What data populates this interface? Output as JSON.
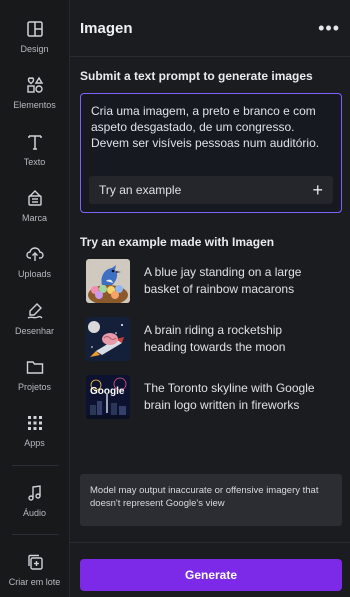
{
  "sidebar": {
    "items": [
      {
        "label": "Design",
        "icon": "layout-icon"
      },
      {
        "label": "Elementos",
        "icon": "shapes-icon"
      },
      {
        "label": "Texto",
        "icon": "text-icon"
      },
      {
        "label": "Marca",
        "icon": "brand-icon"
      },
      {
        "label": "Uploads",
        "icon": "upload-icon"
      },
      {
        "label": "Desenhar",
        "icon": "draw-icon"
      },
      {
        "label": "Projetos",
        "icon": "folder-icon"
      },
      {
        "label": "Apps",
        "icon": "apps-icon"
      },
      {
        "label": "Áudio",
        "icon": "audio-icon"
      },
      {
        "label": "Criar em lote",
        "icon": "bulk-create-icon"
      }
    ]
  },
  "panel": {
    "title": "Imagen",
    "more_label": "•••",
    "prompt_section_title": "Submit a text prompt to generate images",
    "prompt_value": "Cria uma imagem, a preto e branco e com aspeto desgastado, de um congresso. Devem ser visíveis pessoas num auditório.",
    "try_example_label": "Try an example",
    "plus_label": "+",
    "examples_title": "Try an example made with Imagen",
    "examples": [
      {
        "text": "A blue jay standing on a large basket of rainbow macarons"
      },
      {
        "text": "A brain riding a rocketship heading towards the moon"
      },
      {
        "text": "The Toronto skyline with Google brain logo written in fireworks"
      }
    ],
    "notice": "Model may output inaccurate or offensive imagery that doesn't represent Google's view",
    "generate_label": "Generate"
  },
  "colors": {
    "accent": "#7d2ae8",
    "prompt_border": "#7e61ff",
    "panel_bg": "#1b1c1f",
    "sidebar_bg": "#18191b"
  }
}
